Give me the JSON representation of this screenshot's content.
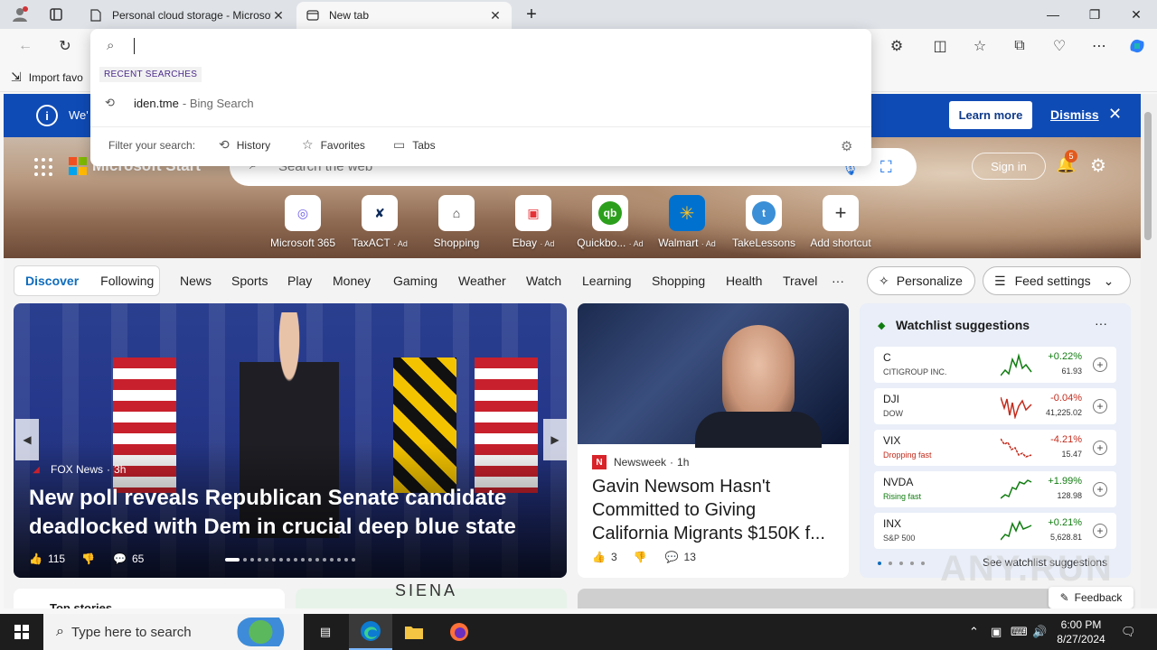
{
  "browser": {
    "tabs": [
      {
        "title": "Personal cloud storage - Microsoft",
        "active": false
      },
      {
        "title": "New tab",
        "active": true
      }
    ],
    "favorites_bar": {
      "import_label": "Import favo"
    }
  },
  "omnibox": {
    "value": "",
    "recent_label": "RECENT SEARCHES",
    "recent": [
      {
        "term": "iden.tme",
        "engine": "- Bing Search"
      }
    ],
    "filter_label": "Filter your search:",
    "filters": [
      "History",
      "Favorites",
      "Tabs"
    ]
  },
  "banner": {
    "message": "We'",
    "learn_more": "Learn more",
    "dismiss": "Dismiss"
  },
  "header": {
    "brand": "Microsoft Start",
    "search_placeholder": "Search the web",
    "sign_in": "Sign in",
    "notifications_count": "5"
  },
  "shortcuts": [
    {
      "label": "Microsoft 365",
      "ad": ""
    },
    {
      "label": "TaxACT",
      "ad": "· Ad"
    },
    {
      "label": "Shopping",
      "ad": ""
    },
    {
      "label": "Ebay",
      "ad": "· Ad"
    },
    {
      "label": "Quickbo...",
      "ad": "· Ad"
    },
    {
      "label": "Walmart",
      "ad": "· Ad"
    },
    {
      "label": "TakeLessons",
      "ad": ""
    },
    {
      "label": "Add shortcut",
      "ad": ""
    }
  ],
  "nav": {
    "discover": "Discover",
    "following": "Following",
    "links": [
      "News",
      "Sports",
      "Play",
      "Money",
      "Gaming",
      "Weather",
      "Watch",
      "Learning",
      "Shopping",
      "Health",
      "Travel"
    ],
    "more": "···",
    "personalize": "Personalize",
    "feed_settings": "Feed settings"
  },
  "main_story": {
    "source": "FOX News",
    "age": "3h",
    "headline": "New poll reveals Republican Senate candidate deadlocked with Dem in crucial deep blue state",
    "likes": "115",
    "comments": "65"
  },
  "side_story": {
    "source": "Newsweek",
    "age": "1h",
    "headline": "Gavin Newsom Hasn't Committed to Giving California Migrants $150K f...",
    "likes": "3",
    "comments": "13"
  },
  "watchlist": {
    "title": "Watchlist suggestions",
    "more": "···",
    "items": [
      {
        "symbol": "C",
        "sub": "CITIGROUP INC.",
        "sub_style": "plain",
        "change": "+0.22%",
        "price": "61.93",
        "dir": "pos"
      },
      {
        "symbol": "DJI",
        "sub": "DOW",
        "sub_style": "plain",
        "change": "-0.04%",
        "price": "41,225.02",
        "dir": "neg"
      },
      {
        "symbol": "VIX",
        "sub": "Dropping fast",
        "sub_style": "red",
        "change": "-4.21%",
        "price": "15.47",
        "dir": "neg"
      },
      {
        "symbol": "NVDA",
        "sub": "Rising fast",
        "sub_style": "green",
        "change": "+1.99%",
        "price": "128.98",
        "dir": "pos"
      },
      {
        "symbol": "INX",
        "sub": "S&P 500",
        "sub_style": "plain",
        "change": "+0.21%",
        "price": "5,628.81",
        "dir": "pos"
      }
    ],
    "see_more": "See watchlist suggestions"
  },
  "bottom": {
    "top_stories": "Top stories",
    "siena": "SIENA",
    "feedback": "Feedback"
  },
  "taskbar": {
    "search_placeholder": "Type here to search",
    "time": "6:00 PM",
    "date": "8/27/2024"
  },
  "watermark": "ANY.RUN"
}
